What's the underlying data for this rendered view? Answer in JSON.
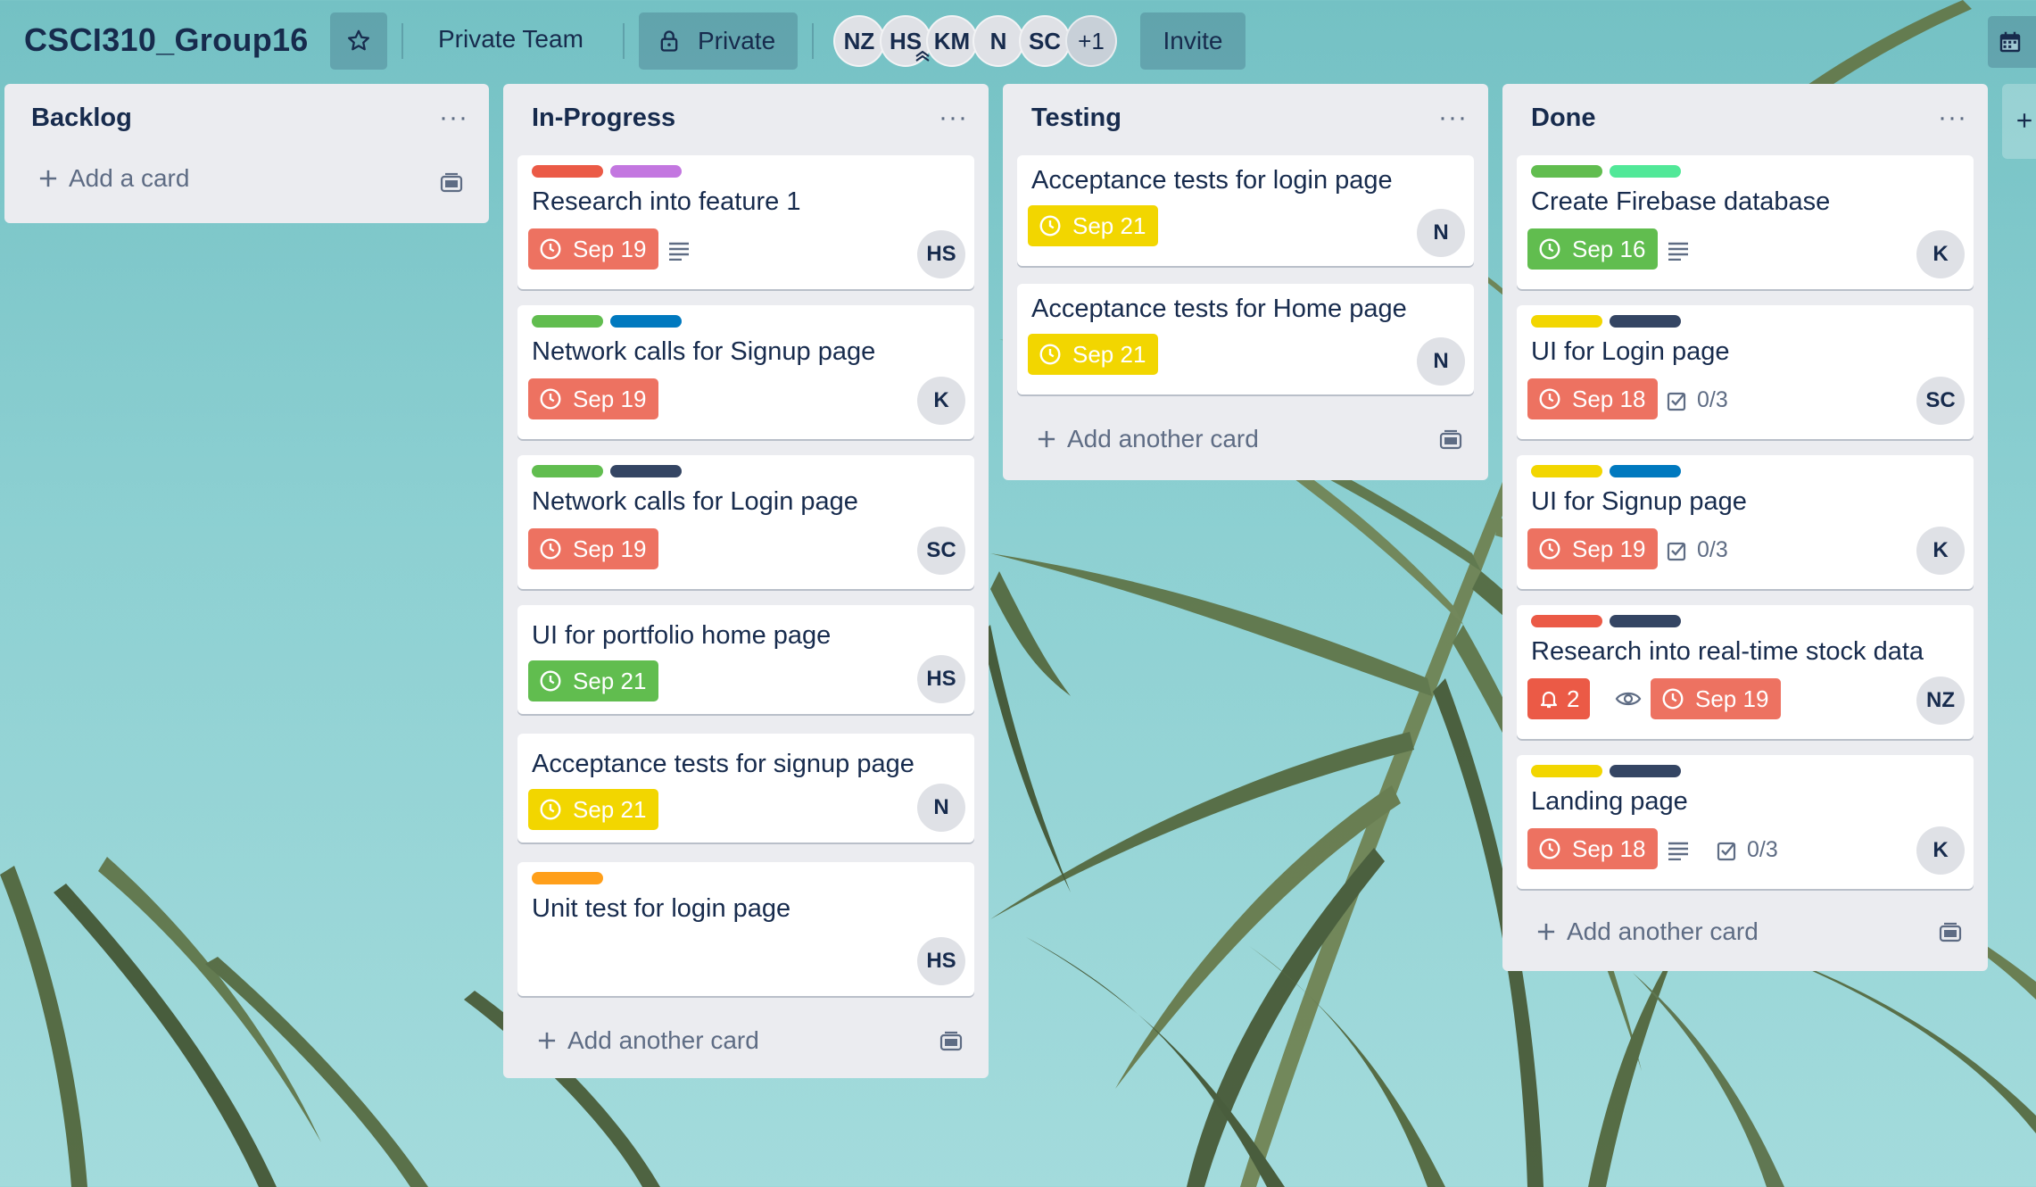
{
  "header": {
    "board_title": "CSCI310_Group16",
    "team": "Private Team",
    "visibility": "Private",
    "members": [
      "NZ",
      "HS",
      "KM",
      "N",
      "SC"
    ],
    "more_members": "+1",
    "invite": "Invite"
  },
  "lists": [
    {
      "title": "Backlog",
      "add_label": "Add a card",
      "cards": []
    },
    {
      "title": "In-Progress",
      "add_label": "Add another card",
      "cards": [
        {
          "title": "Research into feature 1",
          "labels": [
            "#eb5a46",
            "#c377e0"
          ],
          "due": "Sep 19",
          "due_status": "overdue",
          "member": "HS",
          "has_description": true
        },
        {
          "title": "Network calls for Signup page",
          "labels": [
            "#61bd4f",
            "#0079bf"
          ],
          "due": "Sep 19",
          "due_status": "overdue",
          "member": "K"
        },
        {
          "title": "Network calls for Login page",
          "labels": [
            "#61bd4f",
            "#344563"
          ],
          "due": "Sep 19",
          "due_status": "overdue",
          "member": "SC"
        },
        {
          "title": "UI for portfolio home page",
          "labels": [],
          "due": "Sep 21",
          "due_status": "complete",
          "member": "HS"
        },
        {
          "title": "Acceptance tests for signup page",
          "labels": [],
          "due": "Sep 21",
          "due_status": "due-soon",
          "member": "N"
        },
        {
          "title": "Unit test for login page",
          "labels": [
            "#ff9f1a"
          ],
          "member": "HS"
        }
      ]
    },
    {
      "title": "Testing",
      "add_label": "Add another card",
      "cards": [
        {
          "title": "Acceptance tests for login page",
          "due": "Sep 21",
          "due_status": "due-soon",
          "member": "N"
        },
        {
          "title": "Acceptance tests for Home page",
          "due": "Sep 21",
          "due_status": "due-soon",
          "member": "N"
        }
      ]
    },
    {
      "title": "Done",
      "add_label": "Add another card",
      "cards": [
        {
          "title": "Create Firebase database",
          "labels": [
            "#61bd4f",
            "#51e898"
          ],
          "due": "Sep 16",
          "due_status": "complete",
          "member": "K",
          "has_description": true
        },
        {
          "title": "UI for Login page",
          "labels": [
            "#f2d600",
            "#344563"
          ],
          "due": "Sep 18",
          "due_status": "overdue",
          "checklist": "0/3",
          "member": "SC"
        },
        {
          "title": "UI for Signup page",
          "labels": [
            "#f2d600",
            "#0079bf"
          ],
          "due": "Sep 19",
          "due_status": "overdue",
          "checklist": "0/3",
          "member": "K"
        },
        {
          "title": "Research into real-time stock data",
          "labels": [
            "#eb5a46",
            "#344563"
          ],
          "notifications": "2",
          "watching": true,
          "due": "Sep 19",
          "due_status": "overdue",
          "member": "NZ"
        },
        {
          "title": "Landing page",
          "labels": [
            "#f2d600",
            "#344563"
          ],
          "due": "Sep 18",
          "due_status": "overdue",
          "has_description": true,
          "checklist": "0/3",
          "member": "K"
        }
      ]
    }
  ]
}
